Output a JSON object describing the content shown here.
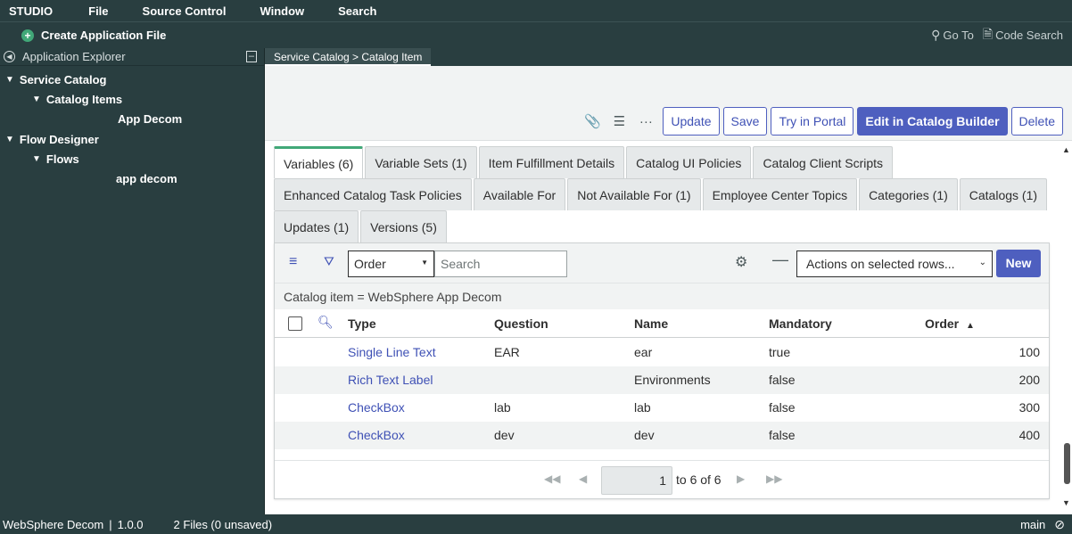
{
  "menubar": {
    "items": [
      "STUDIO",
      "File",
      "Source Control",
      "Window",
      "Search"
    ]
  },
  "appbar": {
    "create_label": "Create Application File",
    "goto_label": "Go To",
    "code_search_label": "Code Search"
  },
  "sidebar": {
    "title": "Application Explorer",
    "collapse_label": "[–]",
    "tree": {
      "service_catalog": "Service Catalog",
      "catalog_items": "Catalog Items",
      "app_decom": "App Decom",
      "flow_designer": "Flow Designer",
      "flows": "Flows",
      "app_decom_flow": "app decom"
    }
  },
  "editor_tab": "Service Catalog > Catalog Item",
  "toolbar": {
    "update": "Update",
    "save": "Save",
    "try_portal": "Try in Portal",
    "edit_builder": "Edit in Catalog Builder",
    "delete": "Delete",
    "more": "···"
  },
  "related_tabs": {
    "row1": [
      "Variables (6)",
      "Variable Sets (1)",
      "Item Fulfillment Details",
      "Catalog UI Policies",
      "Catalog Client Scripts"
    ],
    "row2": [
      "Enhanced Catalog Task Policies",
      "Available For",
      "Not Available For (1)",
      "Employee Center Topics",
      "Categories (1)",
      "Catalogs (1)"
    ],
    "row3": [
      "Updates (1)",
      "Versions (5)"
    ]
  },
  "list": {
    "filter_field": "Order",
    "search_placeholder": "Search",
    "actions_label": "Actions on selected rows...",
    "new_label": "New",
    "condition": "Catalog item = WebSphere App Decom",
    "columns": [
      "Type",
      "Question",
      "Name",
      "Mandatory",
      "Order"
    ],
    "sort_indicator": "▲",
    "rows": [
      {
        "type": "Single Line Text",
        "question": "EAR",
        "name": "ear",
        "mandatory": "true",
        "order": "100"
      },
      {
        "type": "Rich Text Label",
        "question": "",
        "name": "Environments",
        "mandatory": "false",
        "order": "200"
      },
      {
        "type": "CheckBox",
        "question": "lab",
        "name": "lab",
        "mandatory": "false",
        "order": "300"
      },
      {
        "type": "CheckBox",
        "question": "dev",
        "name": "dev",
        "mandatory": "false",
        "order": "400"
      }
    ],
    "pager": {
      "current": "1",
      "range": "to 6 of 6"
    }
  },
  "status": {
    "app": "WebSphere Decom",
    "version": "1.0.0",
    "files": "2 Files (0 unsaved)",
    "branch": "main"
  }
}
